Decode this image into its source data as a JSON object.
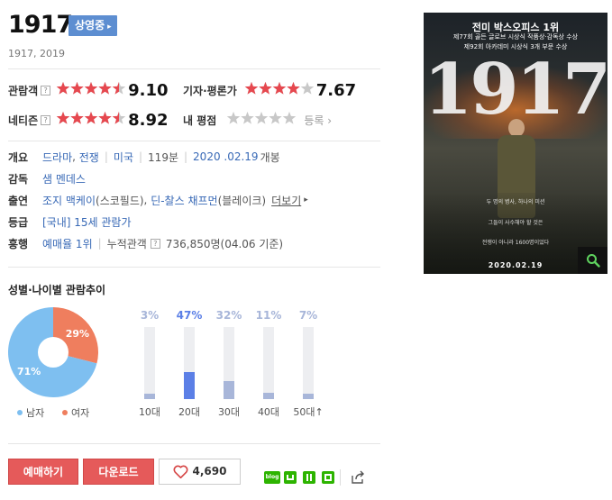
{
  "movie": {
    "title": "1917",
    "status_badge": "상영중",
    "subtitle": "1917, 2019"
  },
  "ratings": {
    "audience": {
      "label": "관람객",
      "help": "?",
      "score": "9.10",
      "stars": 4.5
    },
    "critics": {
      "label": "기자·평론가",
      "score": "7.67",
      "stars": 4
    },
    "netizen": {
      "label": "네티즌",
      "help": "?",
      "score": "8.92",
      "stars": 4.5
    },
    "my": {
      "label": "내 평점",
      "stars": 0,
      "register": "등록"
    }
  },
  "info": {
    "overview": {
      "label": "개요",
      "genre1": "드라마",
      "genre2": "전쟁",
      "country": "미국",
      "runtime": "119분",
      "release_date": "2020 .02.19",
      "release_suffix": "개봉"
    },
    "director": {
      "label": "감독",
      "name": "샘 멘데스"
    },
    "cast": {
      "label": "출연",
      "actor1": "조지 맥케이",
      "role1": "(스코필드)",
      "actor2": "딘-찰스 채프먼",
      "role2": "(블레이크)",
      "more": "더보기"
    },
    "rating": {
      "label": "등급",
      "value": "[국내] 15세 관람가"
    },
    "box_office": {
      "label": "흥행",
      "rank": "예매율 1위",
      "audience_label": "누적관객",
      "help": "?",
      "audience_count": "736,850명(04.06 기준)"
    }
  },
  "audience_chart": {
    "title": "성별·나이별 관람추이",
    "legend_male": "남자",
    "legend_female": "여자"
  },
  "chart_data": [
    {
      "type": "pie",
      "categories": [
        "남자",
        "여자"
      ],
      "values": [
        71,
        29
      ],
      "labels": [
        "71%",
        "29%"
      ],
      "colors": [
        "#7ebff0",
        "#ef7e5e"
      ]
    },
    {
      "type": "bar",
      "categories": [
        "10대",
        "20대",
        "30대",
        "40대",
        "50대↑"
      ],
      "values": [
        3,
        47,
        32,
        11,
        7
      ],
      "labels": [
        "3%",
        "47%",
        "32%",
        "11%",
        "7%"
      ],
      "ylim": [
        0,
        100
      ],
      "highlight": "20대",
      "colors": {
        "normal": "#a8b6d9",
        "highlight": "#5b7fe6",
        "track": "#edeef1"
      }
    }
  ],
  "actions": {
    "reserve": "예매하기",
    "download": "다운로드",
    "likes": "4,690"
  },
  "share": [
    {
      "name": "blog",
      "label": "blog",
      "color": "#2db400"
    },
    {
      "name": "cafe",
      "color": "#2db400"
    },
    {
      "name": "bookmark",
      "color": "#2db400"
    },
    {
      "name": "memo",
      "color": "#2db400"
    }
  ],
  "poster": {
    "line1": "전미 박스오피스 1위",
    "line2": "제77회 골든 글로브 시상식 작품상·감독상 수상",
    "line3": "제92회 아카데미 시상식 3개 부문 수상",
    "title": "1917",
    "tagline1": "두 명의 병사, 하나의 미션",
    "tagline2": "그들이 사수해야 할 것은",
    "tagline3": "전쟁이 아니라 1600명이었다",
    "date": "2020.02.19"
  },
  "colors": {
    "brand_blue": "#5d8ed1",
    "star_red": "#e6484f",
    "button_red": "#e55a5a"
  }
}
